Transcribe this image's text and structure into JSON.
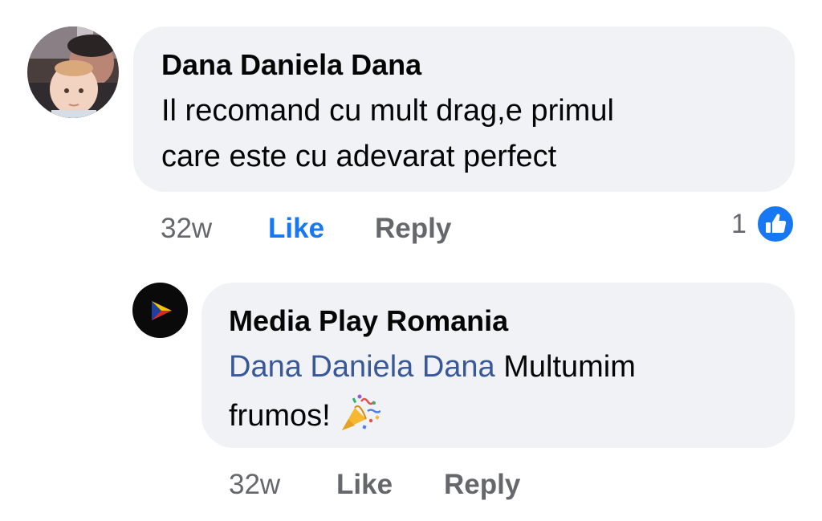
{
  "comment": {
    "author": "Dana Daniela Dana",
    "text_line1": "Il recomand cu mult drag,e primul",
    "text_line2": "care este cu adevarat perfect",
    "time": "32w",
    "like_label": "Like",
    "reply_label": "Reply",
    "reaction_count": "1",
    "reaction_icon": "thumbs-up-icon",
    "like_color": "#1877f2"
  },
  "reply": {
    "author": "Media Play Romania",
    "mention": "Dana Daniela Dana",
    "text_after_mention": "Multumim",
    "text_line2": "frumos!",
    "emoji": "party-popper-icon",
    "time": "32w",
    "like_label": "Like",
    "reply_label": "Reply"
  },
  "colors": {
    "bubble": "#f0f2f5",
    "secondary_text": "#65676b",
    "mention": "#385898"
  }
}
